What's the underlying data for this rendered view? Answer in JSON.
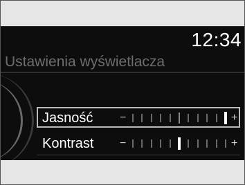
{
  "status": {
    "clock": "12:34"
  },
  "screen": {
    "title": "Ustawienia wyświetlacza"
  },
  "settings": [
    {
      "label": "Jasność",
      "minus": "−",
      "plus": "+",
      "level": 1.0,
      "selected": true
    },
    {
      "label": "Kontrast",
      "minus": "−",
      "plus": "+",
      "level": 0.5,
      "selected": false
    }
  ]
}
